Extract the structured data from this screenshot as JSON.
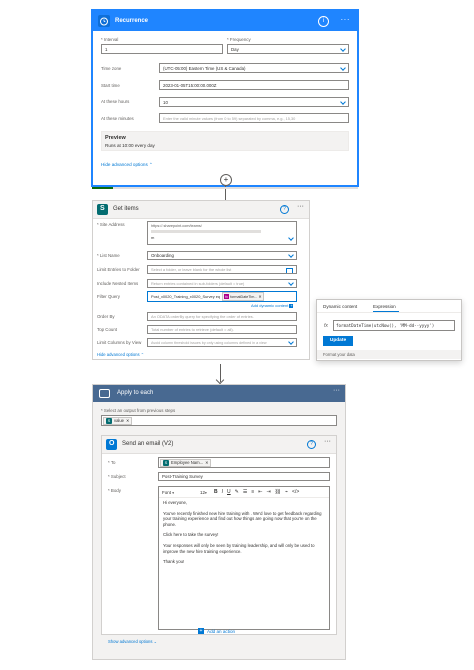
{
  "recurrence": {
    "title": "Recurrence",
    "interval_label": "* Interval",
    "interval_value": "1",
    "frequency_label": "* Frequency",
    "frequency_value": "Day",
    "timezone_label": "Time zone",
    "timezone_value": "(UTC-05:00) Eastern Time (US & Canada)",
    "starttime_label": "Start time",
    "starttime_value": "2023-01-05T15:00:00.000Z",
    "hours_label": "At these hours",
    "hours_value": "10",
    "minutes_label": "At these minutes",
    "minutes_placeholder": "Enter the valid minute values (from 0 to 59) separated by comma, e.g., 15,30",
    "preview_title": "Preview",
    "preview_text": "Runs at 10:00 every day",
    "hide_advanced": "Hide advanced options"
  },
  "get_items": {
    "title": "Get items",
    "site_label": "* Site Address",
    "site_value": "https://.sharepoint.com/teams/",
    "site_value2": "m",
    "list_label": "* List Name",
    "list_value": "Onboarding",
    "folder_label": "Limit Entries to Folder",
    "folder_placeholder": "Select a folder, or leave blank for the whole list",
    "nested_label": "Include Nested Items",
    "nested_placeholder": "Return entries contained in sub-folders (default = true)",
    "filter_label": "Filter Query",
    "filter_text": "Post_x0020_Training_x0020_Survey eq",
    "filter_token": "formatDateTim...",
    "add_dynamic": "Add dynamic content",
    "orderby_label": "Order By",
    "orderby_placeholder": "An ODATA orderBy query for specifying the order of entries.",
    "topcount_label": "Top Count",
    "topcount_placeholder": "Total number of entries to retrieve (default = all).",
    "limitcols_label": "Limit Columns by View",
    "limitcols_placeholder": "Avoid column threshold issues by only using columns defined in a view",
    "hide_advanced": "Hide advanced options"
  },
  "popup": {
    "tab_dynamic": "Dynamic content",
    "tab_expression": "Expression",
    "fx": "fx",
    "expression": "formatDateTime(utcNow(), 'MM-dd--yyyy')",
    "update": "Update",
    "format_data": "Format your data"
  },
  "apply_each": {
    "title": "Apply to each",
    "select_label": "* Select an output from previous steps",
    "token_value": "value"
  },
  "send_email": {
    "title": "Send an email (V2)",
    "to_label": "* To",
    "to_token": "Employee Nam...",
    "subject_label": "* Subject",
    "subject_value": "Post-Training Survey",
    "body_label": "* Body",
    "font_label": "Font",
    "font_size": "12",
    "body_lines": [
      "Hi everyone,",
      "You've recently finished new hire training with            . We'd love to get feedback regarding your training experience and find out how things are going now that you're on the phone.",
      "Click here to take the survey!",
      "Your responses will only be seen by training leadership, and will only be used to improve the new hire training experience.",
      "Thank you!"
    ],
    "show_advanced": "Show advanced options"
  },
  "add_action": "Add an action",
  "colors": {
    "recurrence": "#1f85ff",
    "sharepoint": "#036c70",
    "apply_each": "#486991",
    "outlook": "#0078d4",
    "link": "#0078d4",
    "expression_token": "#ad008c"
  }
}
